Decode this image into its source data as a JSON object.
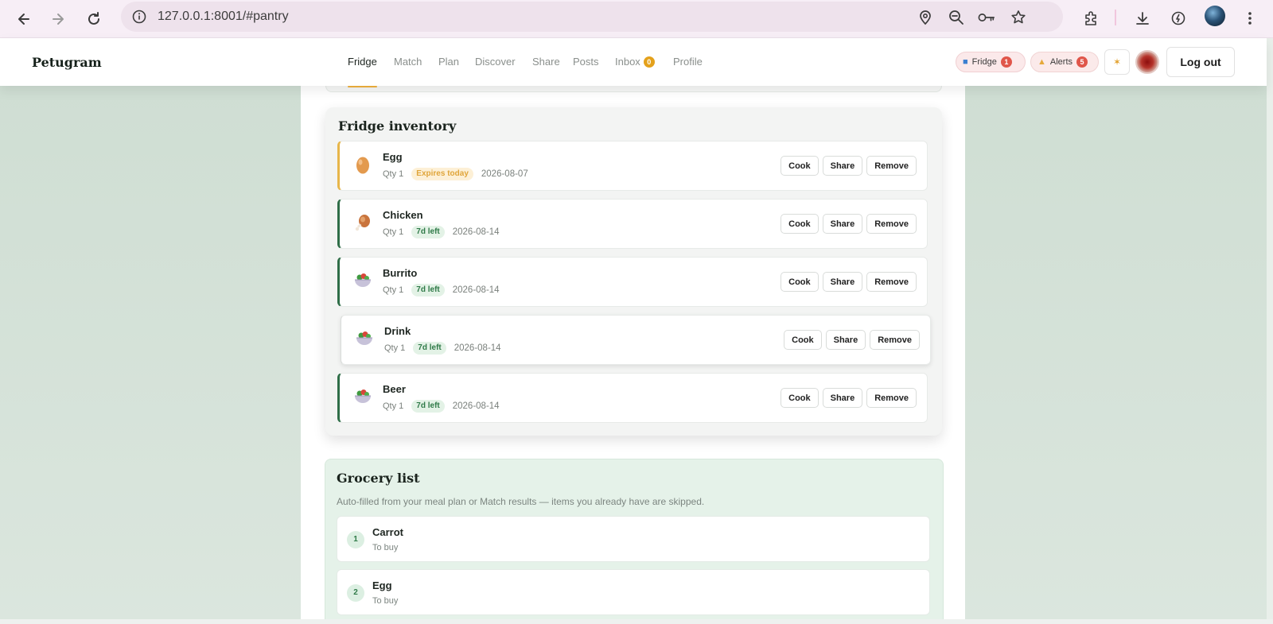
{
  "browser": {
    "url": "127.0.0.1:8001/#pantry"
  },
  "app": {
    "brand": "Petugram",
    "nav": [
      {
        "label": "Fridge",
        "active": true
      },
      {
        "label": "Match"
      },
      {
        "label": "Plan"
      },
      {
        "label": "Discover"
      },
      {
        "label": "Share"
      },
      {
        "label": "Posts"
      },
      {
        "label": "Inbox",
        "badge": "0"
      },
      {
        "label": "Profile"
      }
    ],
    "fridge_pill": {
      "label": "Fridge",
      "count": "1"
    },
    "alerts_pill": {
      "label": "Alerts",
      "count": "5"
    },
    "logout_label": "Log out",
    "accent": "#e5a93a"
  },
  "inventory": {
    "title": "Fridge inventory",
    "items": [
      {
        "name": "Egg",
        "qty": "Qty 1",
        "tag": "Expires today",
        "date": "2026-08-07",
        "icon": "egg-icon",
        "emoji": "🥚"
      },
      {
        "name": "Chicken",
        "qty": "Qty 1",
        "tag": "7d left",
        "date": "2026-08-14",
        "icon": "chicken-leg-icon",
        "emoji": "🍗"
      },
      {
        "name": "Burrito",
        "qty": "Qty 1",
        "tag": "7d left",
        "date": "2026-08-14",
        "icon": "salad-bowl-icon",
        "emoji": "🥗"
      },
      {
        "name": "Drink",
        "qty": "Qty 1",
        "tag": "7d left",
        "date": "2026-08-14",
        "icon": "salad-bowl-icon",
        "emoji": "🥗"
      },
      {
        "name": "Beer",
        "qty": "Qty 1",
        "tag": "7d left",
        "date": "2026-08-14",
        "icon": "salad-bowl-icon",
        "emoji": "🥗"
      }
    ],
    "actions": {
      "cook": "Cook",
      "share": "Share",
      "remove": "Remove"
    }
  },
  "grocery": {
    "title": "Grocery list",
    "subtitle": "Auto-filled from your meal plan or Match results — items you already have are skipped.",
    "items": [
      {
        "num": "1",
        "name": "Carrot",
        "status": "To buy"
      },
      {
        "num": "2",
        "name": "Egg",
        "status": "To buy"
      }
    ]
  }
}
